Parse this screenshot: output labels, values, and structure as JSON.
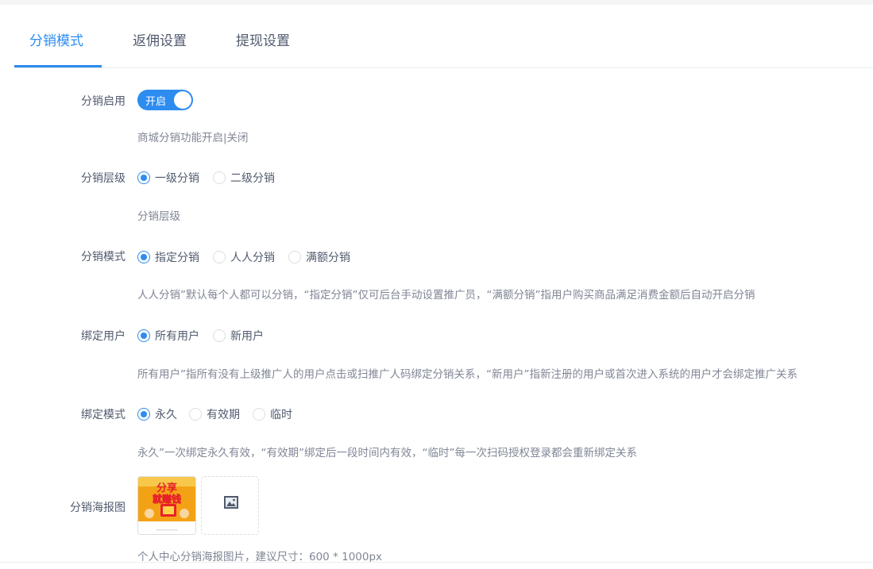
{
  "tabs": [
    "分销模式",
    "返佣设置",
    "提现设置"
  ],
  "form": {
    "enable": {
      "label": "分销启用",
      "switch_text": "开启",
      "on": true,
      "hint": "商城分销功能开启|关闭"
    },
    "level": {
      "label": "分销层级",
      "options": [
        "一级分销",
        "二级分销"
      ],
      "selected": 0,
      "hint": "分销层级"
    },
    "mode": {
      "label": "分销模式",
      "options": [
        "指定分销",
        "人人分销",
        "满额分销"
      ],
      "selected": 0,
      "hint": "人人分销”默认每个人都可以分销，“指定分销”仅可后台手动设置推广员，“满额分销”指用户购买商品满足消费金额后自动开启分销"
    },
    "bind_user": {
      "label": "绑定用户",
      "options": [
        "所有用户",
        "新用户"
      ],
      "selected": 0,
      "hint": "所有用户”指所有没有上级推广人的用户点击或扫推广人码绑定分销关系，“新用户”指新注册的用户或首次进入系统的用户才会绑定推广关系"
    },
    "bind_mode": {
      "label": "绑定模式",
      "options": [
        "永久",
        "有效期",
        "临时"
      ],
      "selected": 0,
      "hint": "永久”一次绑定永久有效，“有效期”绑定后一段时间内有效，“临时”每一次扫码授权登录都会重新绑定关系"
    },
    "poster": {
      "label": "分销海报图",
      "thumb_text": [
        "分享",
        "就赚钱"
      ],
      "upload_icon": "image-icon",
      "hint": "个人中心分销海报图片，建议尺寸：600 * 1000px"
    }
  },
  "colors": {
    "accent": "#2d8cf0",
    "text": "#515a6e",
    "hint": "#808695",
    "border": "#dcdee2"
  }
}
